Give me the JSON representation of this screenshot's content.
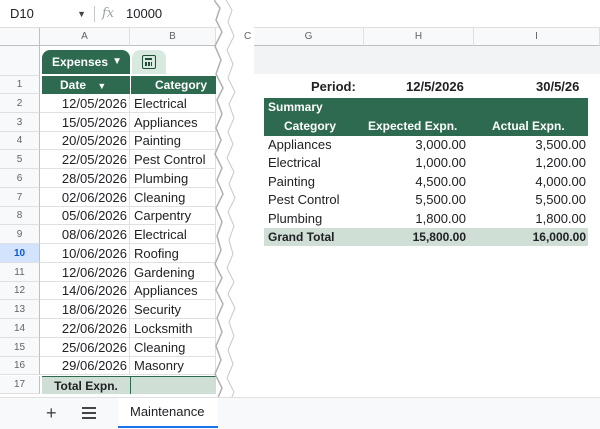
{
  "formula_bar": {
    "cell_ref": "D10",
    "fx": "fx",
    "value": "10000"
  },
  "columns_left": [
    "A",
    "B"
  ],
  "columns_right": [
    "G",
    "H",
    "I"
  ],
  "partial_col": "C",
  "table": {
    "name": "Expenses",
    "headers": {
      "date": "Date",
      "category": "Category"
    },
    "rows": [
      {
        "n": "2",
        "date": "12/05/2026",
        "category": "Electrical"
      },
      {
        "n": "3",
        "date": "15/05/2026",
        "category": "Appliances"
      },
      {
        "n": "4",
        "date": "20/05/2026",
        "category": "Painting"
      },
      {
        "n": "5",
        "date": "22/05/2026",
        "category": "Pest Control"
      },
      {
        "n": "6",
        "date": "28/05/2026",
        "category": "Plumbing"
      },
      {
        "n": "7",
        "date": "02/06/2026",
        "category": "Cleaning"
      },
      {
        "n": "8",
        "date": "05/06/2026",
        "category": "Carpentry"
      },
      {
        "n": "9",
        "date": "08/06/2026",
        "category": "Electrical"
      },
      {
        "n": "10",
        "date": "10/06/2026",
        "category": "Roofing"
      },
      {
        "n": "11",
        "date": "12/06/2026",
        "category": "Gardening"
      },
      {
        "n": "12",
        "date": "14/06/2026",
        "category": "Appliances"
      },
      {
        "n": "13",
        "date": "18/06/2026",
        "category": "Security"
      },
      {
        "n": "14",
        "date": "22/06/2026",
        "category": "Locksmith"
      },
      {
        "n": "15",
        "date": "25/06/2026",
        "category": "Cleaning"
      },
      {
        "n": "16",
        "date": "29/06/2026",
        "category": "Masonry"
      }
    ],
    "header_row_num": "1",
    "total_row_num": "17",
    "total_label": "Total Expn."
  },
  "period": {
    "label": "Period:",
    "start": "12/5/2026",
    "end": "30/5/26"
  },
  "summary": {
    "title": "Summary",
    "headers": {
      "category": "Category",
      "expected": "Expected Expn.",
      "actual": "Actual Expn."
    },
    "rows": [
      {
        "category": "Appliances",
        "expected": "3,000.00",
        "actual": "3,500.00"
      },
      {
        "category": "Electrical",
        "expected": "1,000.00",
        "actual": "1,200.00"
      },
      {
        "category": "Painting",
        "expected": "4,500.00",
        "actual": "4,000.00"
      },
      {
        "category": "Pest Control",
        "expected": "5,500.00",
        "actual": "5,500.00"
      },
      {
        "category": "Plumbing",
        "expected": "1,800.00",
        "actual": "1,800.00"
      }
    ],
    "grand_total": {
      "label": "Grand Total",
      "expected": "15,800.00",
      "actual": "16,000.00"
    }
  },
  "sheet_tab": "Maintenance",
  "colors": {
    "header_green": "#2d6a4f",
    "total_green": "#cfdfd6",
    "selection_blue": "#1a73e8"
  }
}
